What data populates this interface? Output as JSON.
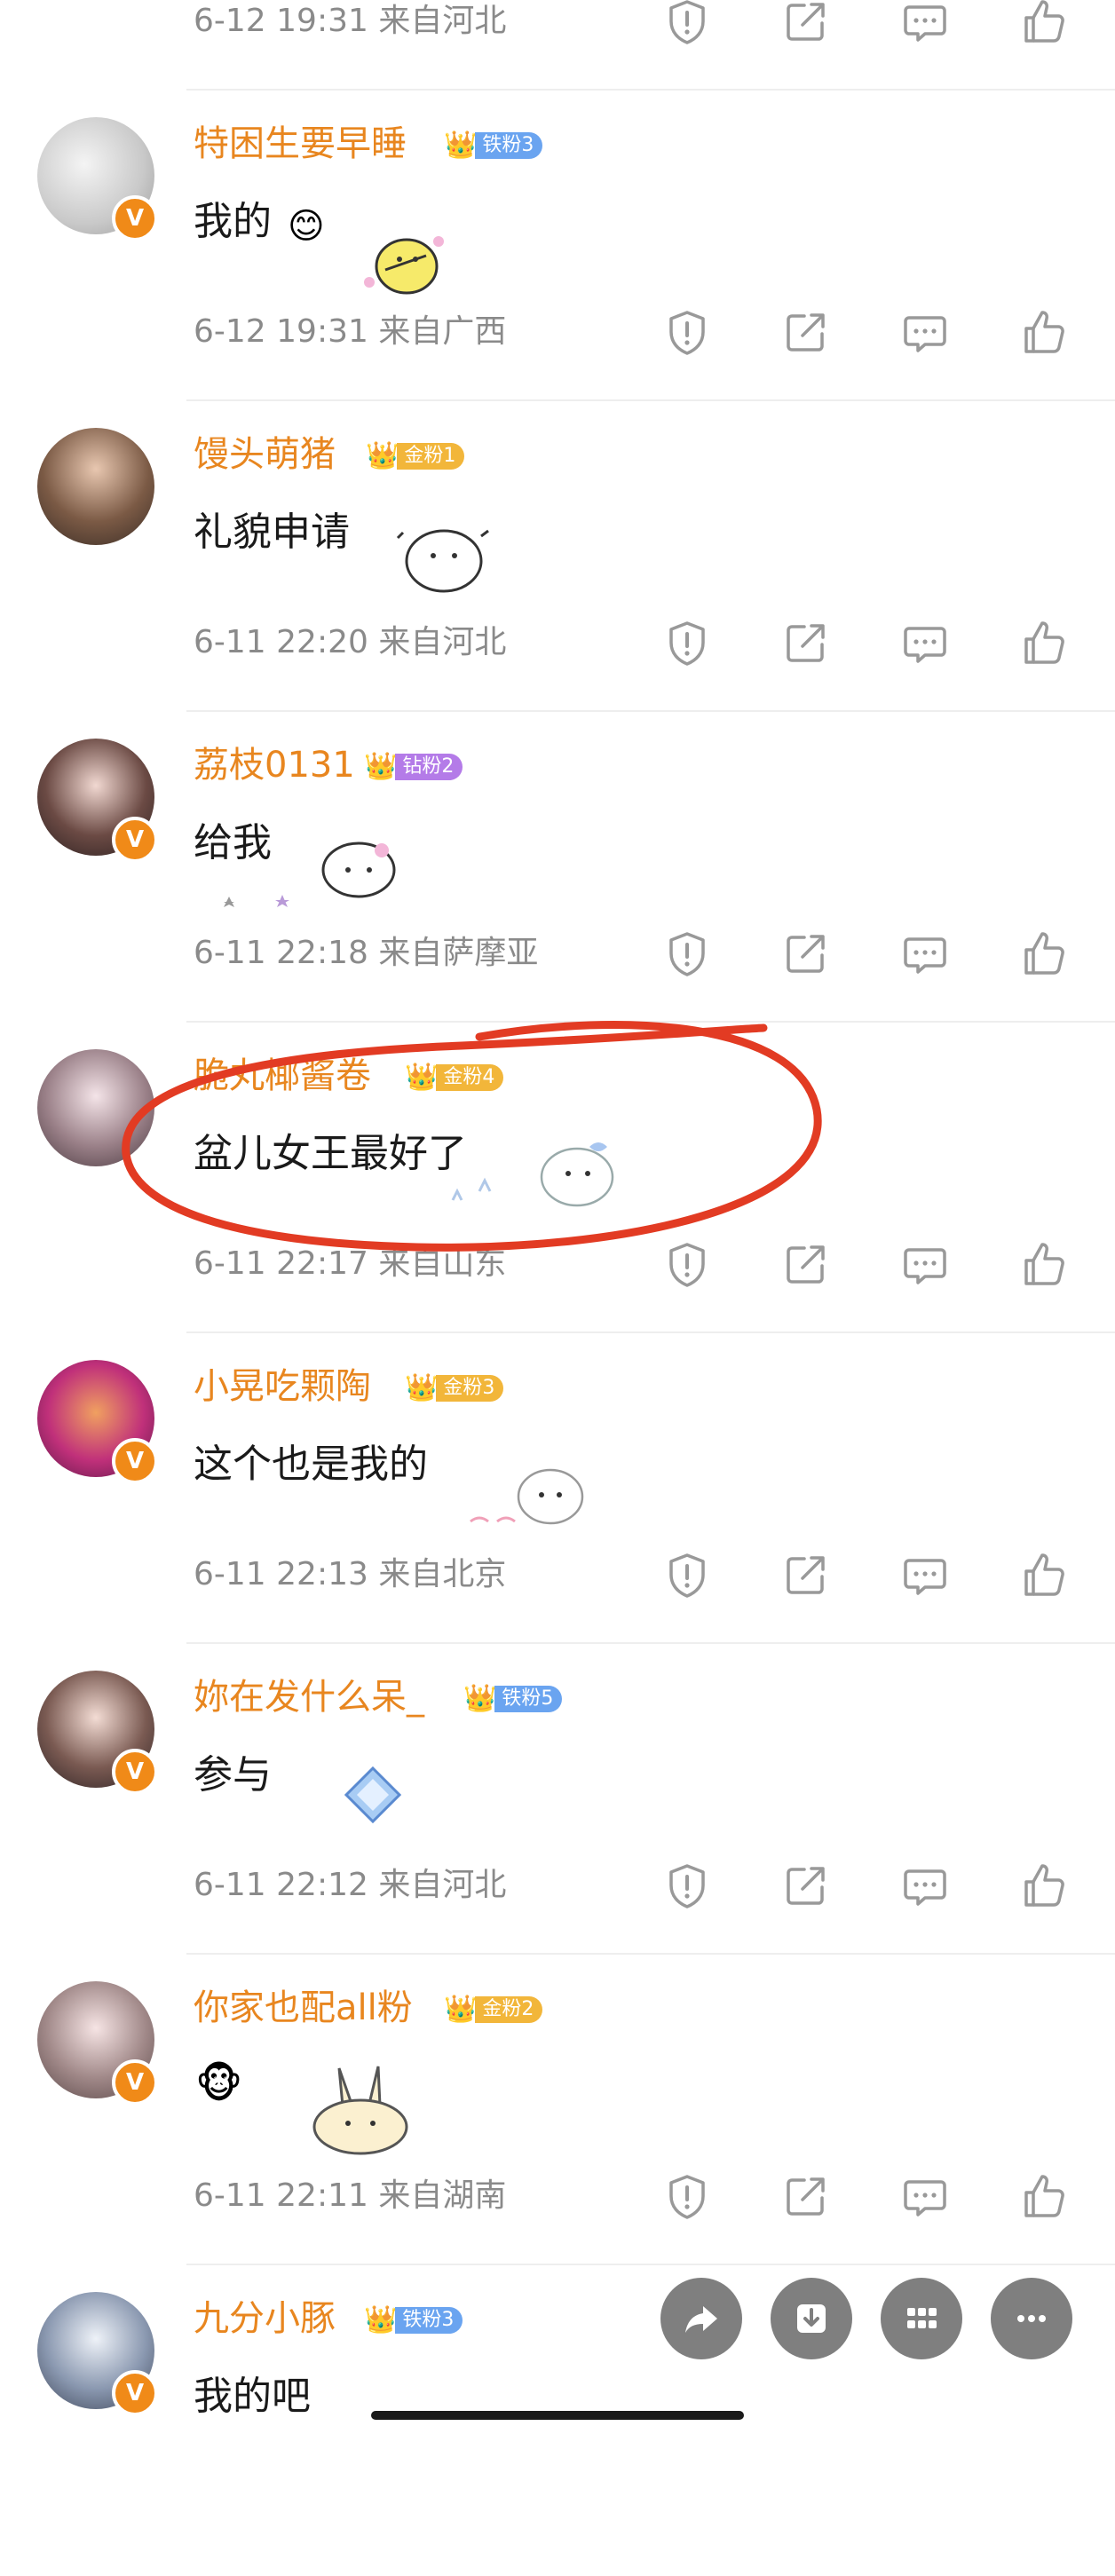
{
  "top_row": {
    "meta": "6-12 19:31  来自河北"
  },
  "comments": [
    {
      "user": "特困生要早睡",
      "fan_label": "铁粉3",
      "fan_color": "#6aa4f0",
      "text": "我的",
      "meta": "6-12 19:31  来自广西"
    },
    {
      "user": "馒头萌猪",
      "fan_label": "金粉1",
      "fan_color": "#f2b63a",
      "text": "礼貌申请",
      "meta": "6-11 22:20  来自河北"
    },
    {
      "user": "荔枝0131",
      "fan_label": "钻粉2",
      "fan_color": "#b47be8",
      "text": "给我",
      "meta": "6-11 22:18  来自萨摩亚"
    },
    {
      "user": "脆丸椰酱卷",
      "fan_label": "金粉4",
      "fan_color": "#f2b63a",
      "text": "盆儿女王最好了",
      "meta": "6-11 22:17  来自山东"
    },
    {
      "user": "小晃吃颗陶",
      "fan_label": "金粉3",
      "fan_color": "#f2b63a",
      "text": "这个也是我的",
      "meta": "6-11 22:13  来自北京"
    },
    {
      "user": "妳在发什么呆_",
      "fan_label": "铁粉5",
      "fan_color": "#6aa4f0",
      "text": "参与",
      "meta": "6-11 22:12  来自河北"
    },
    {
      "user": "你家也配all粉",
      "fan_label": "金粉2",
      "fan_color": "#f2b63a",
      "text": "",
      "meta": "6-11 22:11  来自湖南"
    },
    {
      "user": "九分小豚",
      "fan_label": "铁粉3",
      "fan_color": "#6aa4f0",
      "text": "我的吧",
      "meta": ""
    }
  ],
  "icons": {
    "report": "shield-exclamation-icon",
    "share": "share-arrow-icon",
    "comment": "comment-bubble-icon",
    "like": "thumbs-up-icon"
  },
  "fab": {
    "share": "share-arrow-icon",
    "save": "download-icon",
    "apps": "grid-icon",
    "more": "more-dots-icon"
  },
  "colors": {
    "username": "#e8861f",
    "meta": "#8a8a8a",
    "vip_badge": "#f08a18",
    "highlight_circle": "#e23b23"
  }
}
